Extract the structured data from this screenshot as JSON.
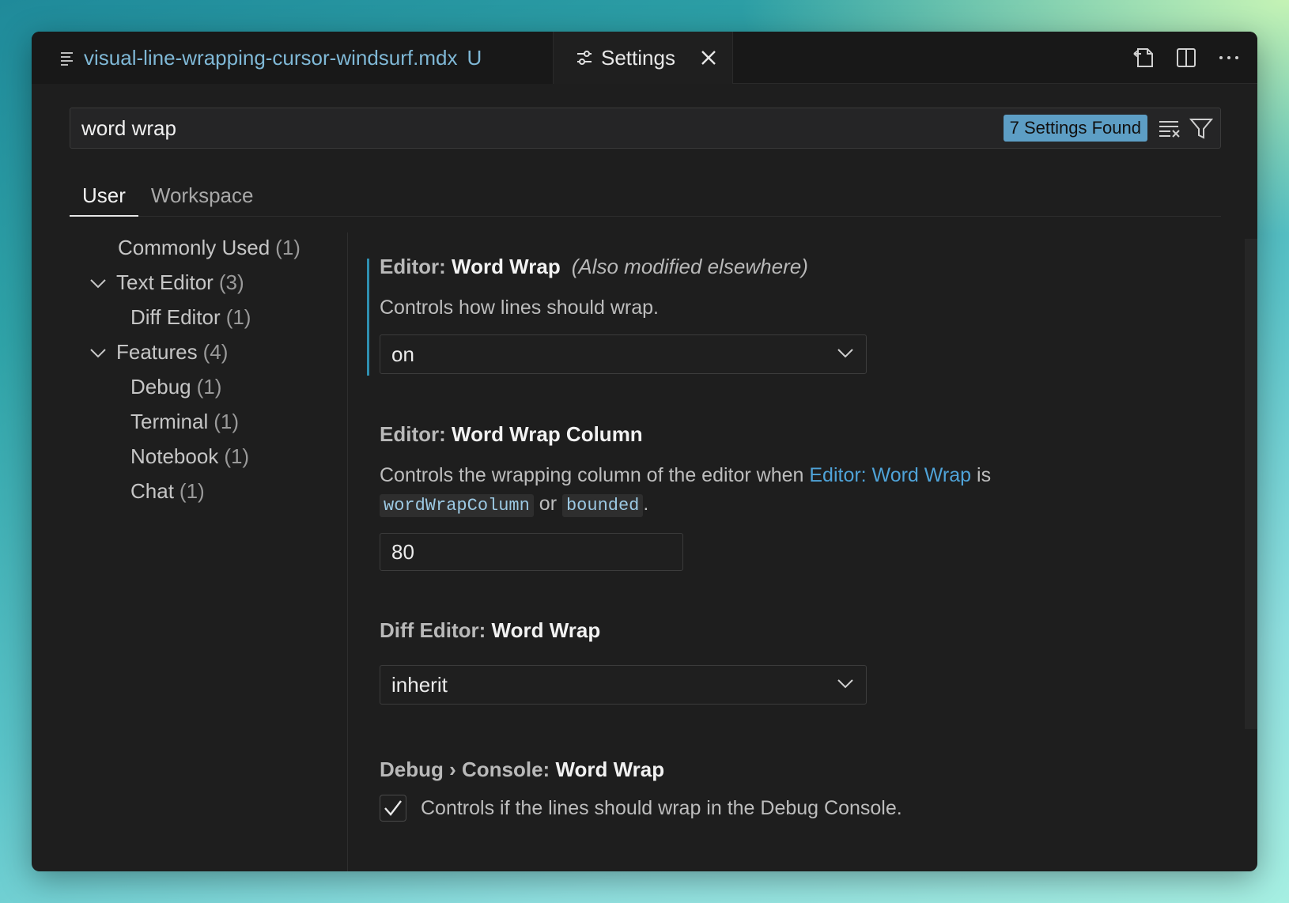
{
  "tabs": {
    "file": {
      "name": "visual-line-wrapping-cursor-windsurf.mdx",
      "status": "U"
    },
    "settings": {
      "label": "Settings"
    }
  },
  "search": {
    "value": "word wrap",
    "results": "7 Settings Found"
  },
  "scopes": [
    "User",
    "Workspace"
  ],
  "toc": [
    {
      "label": "Commonly Used",
      "count": "(1)"
    },
    {
      "label": "Text Editor",
      "count": "(3)"
    },
    {
      "label": "Diff Editor",
      "count": "(1)"
    },
    {
      "label": "Features",
      "count": "(4)"
    },
    {
      "label": "Debug",
      "count": "(1)"
    },
    {
      "label": "Terminal",
      "count": "(1)"
    },
    {
      "label": "Notebook",
      "count": "(1)"
    },
    {
      "label": "Chat",
      "count": "(1)"
    }
  ],
  "settings": {
    "word_wrap": {
      "category": "Editor: ",
      "name": "Word Wrap",
      "also": "(Also modified elsewhere)",
      "desc": "Controls how lines should wrap.",
      "value": "on"
    },
    "word_wrap_column": {
      "category": "Editor: ",
      "name": "Word Wrap Column",
      "desc_pre": "Controls the wrapping column of the editor when ",
      "desc_link": "Editor: Word Wrap",
      "desc_is": " is",
      "code1": "wordWrapColumn",
      "desc_or": " or ",
      "code2": "bounded",
      "desc_end": ".",
      "value": "80"
    },
    "diff_word_wrap": {
      "category": "Diff Editor: ",
      "name": "Word Wrap",
      "value": "inherit"
    },
    "debug_word_wrap": {
      "category": "Debug › Console: ",
      "name": "Word Wrap",
      "desc": "Controls if the lines should wrap in the Debug Console.",
      "checked": true
    }
  },
  "colors": {
    "accent": "#5d9ec5",
    "link": "#4fa3d8",
    "modified": "#2f8fb0"
  }
}
